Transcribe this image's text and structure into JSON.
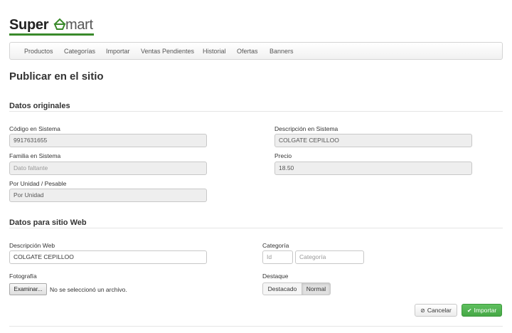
{
  "brand": {
    "name_bold": "Super",
    "name_light": "mart",
    "accent": "#3a8a2b"
  },
  "nav": {
    "items": [
      "Productos",
      "Categorías",
      "Importar",
      "Ventas Pendientes",
      "Historial",
      "Ofertas",
      "Banners"
    ]
  },
  "page": {
    "title": "Publicar en el sitio"
  },
  "original": {
    "section_title": "Datos originales",
    "codigo_label": "Código en Sistema",
    "codigo_value": "9917631655",
    "descripcion_label": "Descripción en Sistema",
    "descripcion_value": "COLGATE CEPILLOO",
    "familia_label": "Familia en Sistema",
    "familia_placeholder": "Dato faltante",
    "precio_label": "Precio",
    "precio_value": "18.50",
    "unidad_label": "Por Unidad / Pesable",
    "unidad_value": "Por Unidad"
  },
  "web": {
    "section_title": "Datos para sitio Web",
    "descripcion_label": "Descripción Web",
    "descripcion_value": "COLGATE CEPILLOO",
    "categoria_label": "Categoría",
    "categoria_id_placeholder": "Id",
    "categoria_name_placeholder": "Categoría",
    "foto_label": "Fotografía",
    "foto_button": "Examinar...",
    "foto_status": "No se seleccionó un archivo.",
    "destaque_label": "Destaque",
    "destaque_options": [
      "Destacado",
      "Normal"
    ],
    "destaque_selected": "Normal"
  },
  "actions": {
    "cancel_label": "Cancelar",
    "import_label": "Importar",
    "import_color": "#4cae4c"
  }
}
